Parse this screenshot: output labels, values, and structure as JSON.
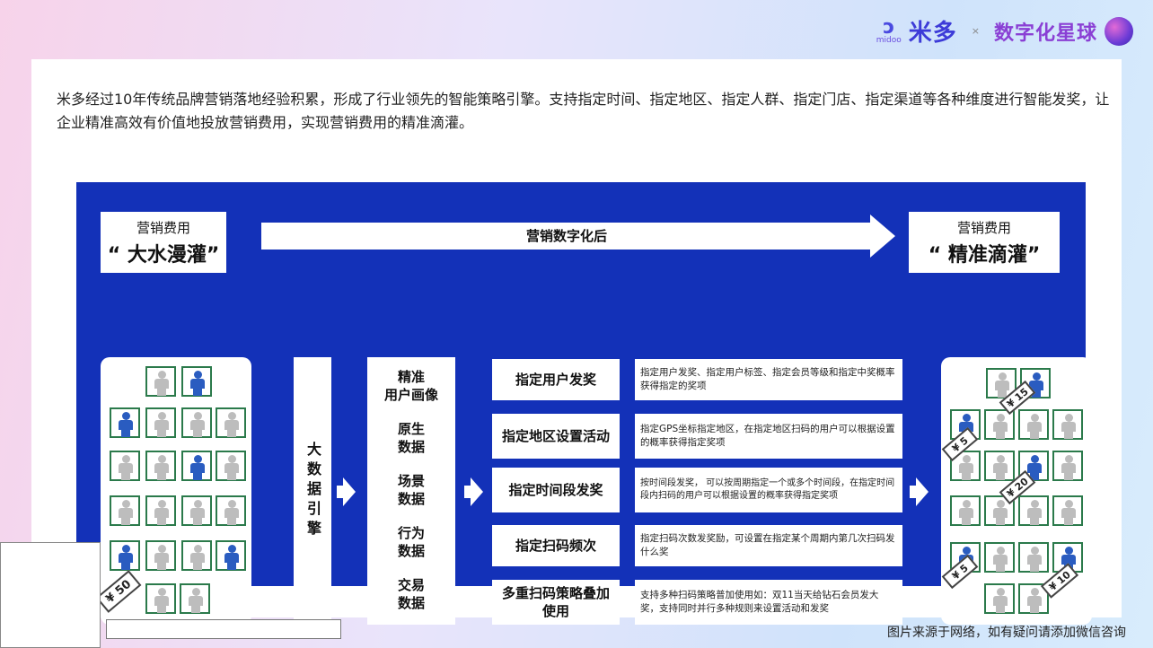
{
  "brand": {
    "logo_glyph": "ↄ",
    "logo_small": "midoo",
    "name": "米多",
    "separator": "×",
    "partner": "数字化星球"
  },
  "intro": "米多经过10年传统品牌营销落地经验积累，形成了行业领先的智能策略引擎。支持指定时间、指定地区、指定人群、指定门店、指定渠道等各种维度进行智能发奖，让企业精准高效有价值地投放营销费用，实现营销费用的精准滴灌。",
  "left_title": {
    "sub": "营销费用",
    "main": "“ 大水漫灌”"
  },
  "right_title": {
    "sub": "营销费用",
    "main": "“ 精准滴灌”"
  },
  "arrow_label": "营销数字化后",
  "engine_label": "大数据引擎",
  "data_items": [
    {
      "line1": "精准",
      "line2": "用户画像"
    },
    {
      "line1": "原生",
      "line2": "数据"
    },
    {
      "line1": "场景",
      "line2": "数据"
    },
    {
      "line1": "行为",
      "line2": "数据"
    },
    {
      "line1": "交易",
      "line2": "数据"
    }
  ],
  "strategies": [
    {
      "name": "指定用户发奖",
      "desc": "指定用户发奖、指定用户标签、指定会员等级和指定中奖概率获得指定的奖项"
    },
    {
      "name": "指定地区设置活动",
      "desc": "指定GPS坐标指定地区，在指定地区扫码的用户可以根据设置的概率获得指定奖项"
    },
    {
      "name": "指定时间段发奖",
      "desc": "按时间段发奖， 可以按周期指定一个或多个时间段，在指定时间段内扫码的用户可以根据设置的概率获得指定奖项"
    },
    {
      "name": "指定扫码频次",
      "desc": "指定扫码次数发奖励，可设置在指定某个周期内第几次扫码发什么奖"
    },
    {
      "name": "多重扫码策略叠加使用",
      "desc": "支持多种扫码策略普加使用如：双11当天给钻石会员发大奖，支持同时并行多种规则来设置活动和发奖"
    }
  ],
  "left_tag": "¥ 50",
  "right_tags": [
    "¥ 15",
    "¥ 5",
    "¥ 20",
    "¥ 5",
    "¥ 10"
  ],
  "source_note": "图片来源于网络，如有疑问请添加微信咨询",
  "colors": {
    "panel": "#1331b8",
    "person_border": "#2b7a4b",
    "person_blue": "#2a5cc0",
    "person_gray": "#bdbdbd"
  }
}
